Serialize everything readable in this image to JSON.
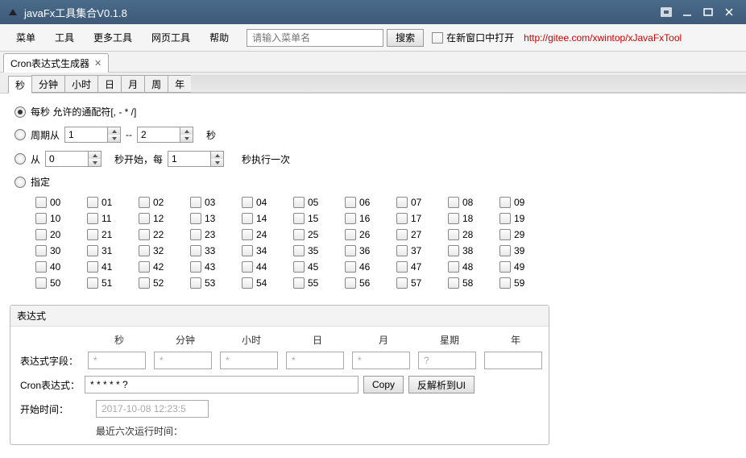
{
  "title": "javaFx工具集合V0.1.8",
  "menus": [
    "菜单",
    "工具",
    "更多工具",
    "网页工具",
    "帮助"
  ],
  "search_placeholder": "请输入菜单名",
  "search_btn": "搜索",
  "open_new_window": "在新窗口中打开",
  "link": "http://gitee.com/xwintop/xJavaFxTool",
  "tab": {
    "label": "Cron表达式生成器"
  },
  "subtabs": [
    "秒",
    "分钟",
    "小时",
    "日",
    "月",
    "周",
    "年"
  ],
  "opt_wildcard": "每秒 允许的通配符[, - * /]",
  "opt_cycle_from": "周期从",
  "opt_cycle_dash": "--",
  "opt_cycle_unit": "秒",
  "opt_from": "从",
  "opt_from_suffix": "秒开始，每",
  "opt_from_tail": "秒执行一次",
  "opt_specify": "指定",
  "spin1": "1",
  "spin2": "2",
  "spin3": "0",
  "spin4": "1",
  "seconds": [
    "00",
    "01",
    "02",
    "03",
    "04",
    "05",
    "06",
    "07",
    "08",
    "09",
    "10",
    "11",
    "12",
    "13",
    "14",
    "15",
    "16",
    "17",
    "18",
    "19",
    "20",
    "21",
    "22",
    "23",
    "24",
    "25",
    "26",
    "27",
    "28",
    "29",
    "30",
    "31",
    "32",
    "33",
    "34",
    "35",
    "36",
    "37",
    "38",
    "39",
    "40",
    "41",
    "42",
    "43",
    "44",
    "45",
    "46",
    "47",
    "48",
    "49",
    "50",
    "51",
    "52",
    "53",
    "54",
    "55",
    "56",
    "57",
    "58",
    "59"
  ],
  "expr": {
    "title": "表达式",
    "headers": [
      "秒",
      "分钟",
      "小时",
      "日",
      "月",
      "星期",
      "年"
    ],
    "field_label": "表达式字段：",
    "fields": [
      "*",
      "*",
      "*",
      "*",
      "*",
      "?",
      ""
    ],
    "cron_label": "Cron表达式：",
    "cron_value": "* * * * * ?",
    "copy": "Copy",
    "parse": "反解析到UI",
    "start_label": "开始时间：",
    "start_value": "2017-10-08 12:23:5",
    "recent_label": "最近六次运行时间："
  }
}
